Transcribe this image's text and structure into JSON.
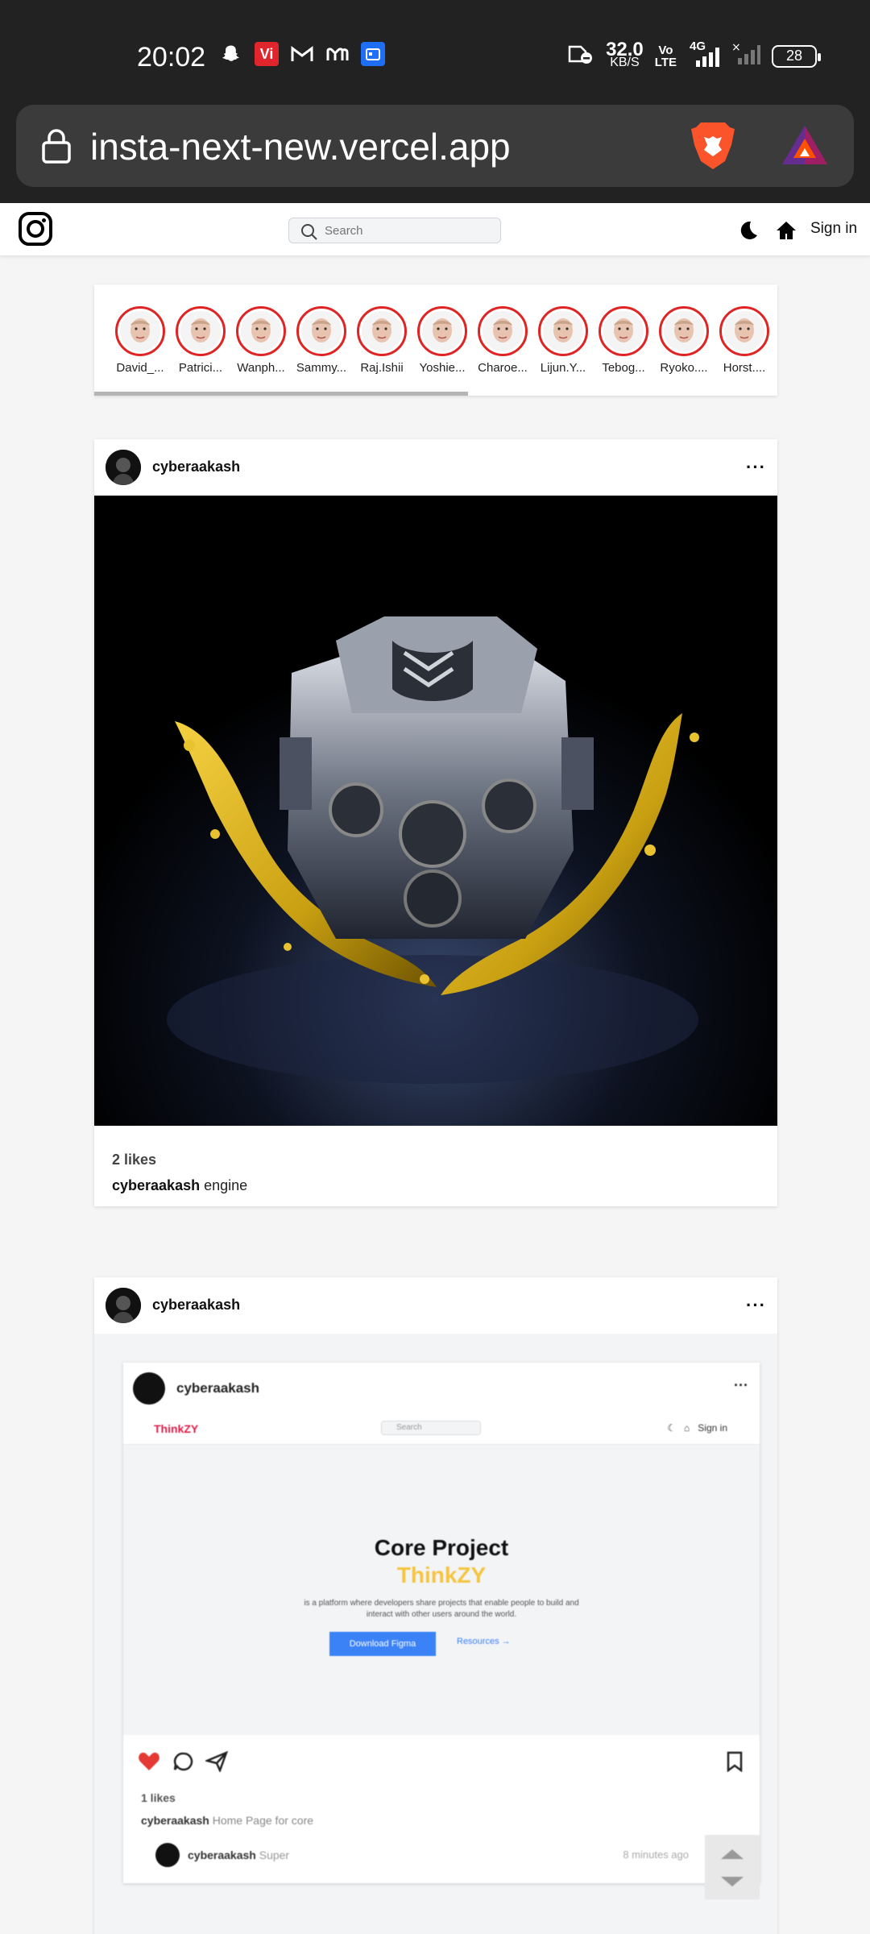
{
  "status_bar": {
    "time": "20:02",
    "net_speed_value": "32.0",
    "net_speed_unit": "KB/S",
    "volte_label_top": "Vo",
    "volte_label_bottom": "LTE",
    "network_type": "4G",
    "battery": "28",
    "vi_label": "Vi"
  },
  "browser": {
    "url": "insta-next-new.vercel.app"
  },
  "header": {
    "search_placeholder": "Search",
    "signin_label": "Sign in"
  },
  "stories": [
    {
      "name": "David_..."
    },
    {
      "name": "Patrici..."
    },
    {
      "name": "Wanph..."
    },
    {
      "name": "Sammy..."
    },
    {
      "name": "Raj.Ishii"
    },
    {
      "name": "Yoshie..."
    },
    {
      "name": "Charoe..."
    },
    {
      "name": "Lijun.Y..."
    },
    {
      "name": "Tebog..."
    },
    {
      "name": "Ryoko...."
    },
    {
      "name": "Horst...."
    }
  ],
  "posts": [
    {
      "username": "cyberaakash",
      "more": "···",
      "likes": "2 likes",
      "caption_user": "cyberaakash",
      "caption_text": "engine"
    },
    {
      "username": "cyberaakash",
      "more": "···",
      "inner": {
        "username": "cyberaakash",
        "more": "···",
        "logo": "ThinkZY",
        "search": "Search",
        "signin": "Sign in",
        "hero_title": "Core Project",
        "hero_brand": "ThinkZY",
        "hero_desc": "is a platform where developers share projects that enable people to build and interact with other users around the world.",
        "hero_primary": "Download Figma",
        "hero_secondary": "Resources →",
        "likes": "1 likes",
        "caption_user": "cyberaakash",
        "caption_text": "Home Page for core",
        "comment_user": "cyberaakash",
        "comment_text": "Super",
        "comment_time": "8 minutes ago"
      }
    }
  ],
  "colors": {
    "story_ring": "#e02424",
    "like_heart": "#e53935",
    "brand_yellow": "#f5c542",
    "button_blue": "#3b82f6"
  }
}
